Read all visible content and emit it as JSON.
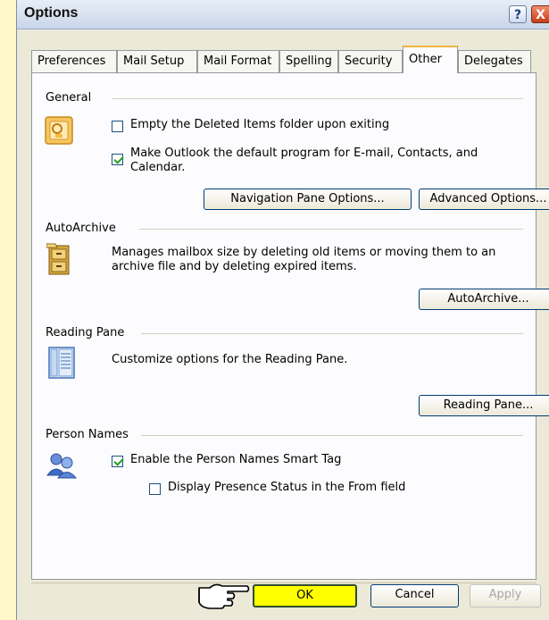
{
  "window": {
    "title": "Options"
  },
  "titlebar_buttons": {
    "help": "?",
    "close": "X"
  },
  "tabs": [
    {
      "label": "Preferences"
    },
    {
      "label": "Mail Setup"
    },
    {
      "label": "Mail Format"
    },
    {
      "label": "Spelling"
    },
    {
      "label": "Security"
    },
    {
      "label": "Other"
    },
    {
      "label": "Delegates"
    }
  ],
  "active_tab": "Other",
  "general": {
    "heading": "General",
    "empty_deleted_label": "Empty the Deleted Items folder upon exiting",
    "empty_deleted_checked": false,
    "default_program_label_line1": "Make Outlook the default program for E-mail, Contacts, and",
    "default_program_label_line2": "Calendar.",
    "default_program_checked": true,
    "nav_pane_button": "Navigation Pane Options...",
    "advanced_button": "Advanced Options..."
  },
  "autoarchive": {
    "heading": "AutoArchive",
    "description_line1": "Manages mailbox size by deleting old items or moving them to an",
    "description_line2": "archive file and by deleting expired items.",
    "button": "AutoArchive..."
  },
  "reading_pane": {
    "heading": "Reading Pane",
    "description": "Customize options for the Reading Pane.",
    "button": "Reading Pane..."
  },
  "person_names": {
    "heading": "Person Names",
    "smart_tag_label": "Enable the Person Names Smart Tag",
    "smart_tag_checked": true,
    "presence_label": "Display Presence Status in the From field",
    "presence_checked": false
  },
  "footer": {
    "ok": "OK",
    "cancel": "Cancel",
    "apply": "Apply"
  },
  "colors": {
    "highlight_ok": "#ffff00",
    "background": "#fff8c9",
    "dialog": "#ece9d8",
    "active_tab_accent": "#f0b63e"
  }
}
